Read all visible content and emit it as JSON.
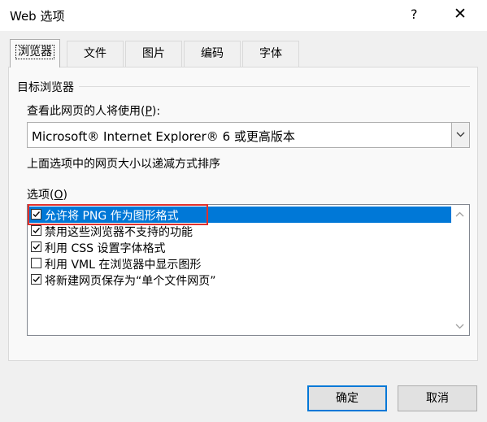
{
  "window": {
    "title": "Web 选项",
    "help": "?",
    "close": "✕"
  },
  "tabs": [
    {
      "label": "浏览器",
      "active": true
    },
    {
      "label": "文件"
    },
    {
      "label": "图片"
    },
    {
      "label": "编码"
    },
    {
      "label": "字体"
    }
  ],
  "browser": {
    "group_label": "目标浏览器",
    "question_prefix": "查看此网页的人将使用(",
    "question_key": "P",
    "question_suffix": "):",
    "selected_browser": "Microsoft® Internet Explorer® 6 或更高版本",
    "note": "上面选项中的网页大小以递减方式排序",
    "options_prefix": "选项(",
    "options_key": "O",
    "options_suffix": ")",
    "options": [
      {
        "label": "允许将 PNG 作为图形格式",
        "checked": true,
        "selected": true
      },
      {
        "label": "禁用这些浏览器不支持的功能",
        "checked": true
      },
      {
        "label": "利用 CSS 设置字体格式",
        "checked": true
      },
      {
        "label": "利用 VML 在浏览器中显示图形",
        "checked": false
      },
      {
        "label": "将新建网页保存为“单个文件网页”",
        "checked": true
      }
    ]
  },
  "buttons": {
    "ok": "确定",
    "cancel": "取消"
  },
  "colors": {
    "selection": "#0078d7",
    "annotation": "#e0302c"
  }
}
